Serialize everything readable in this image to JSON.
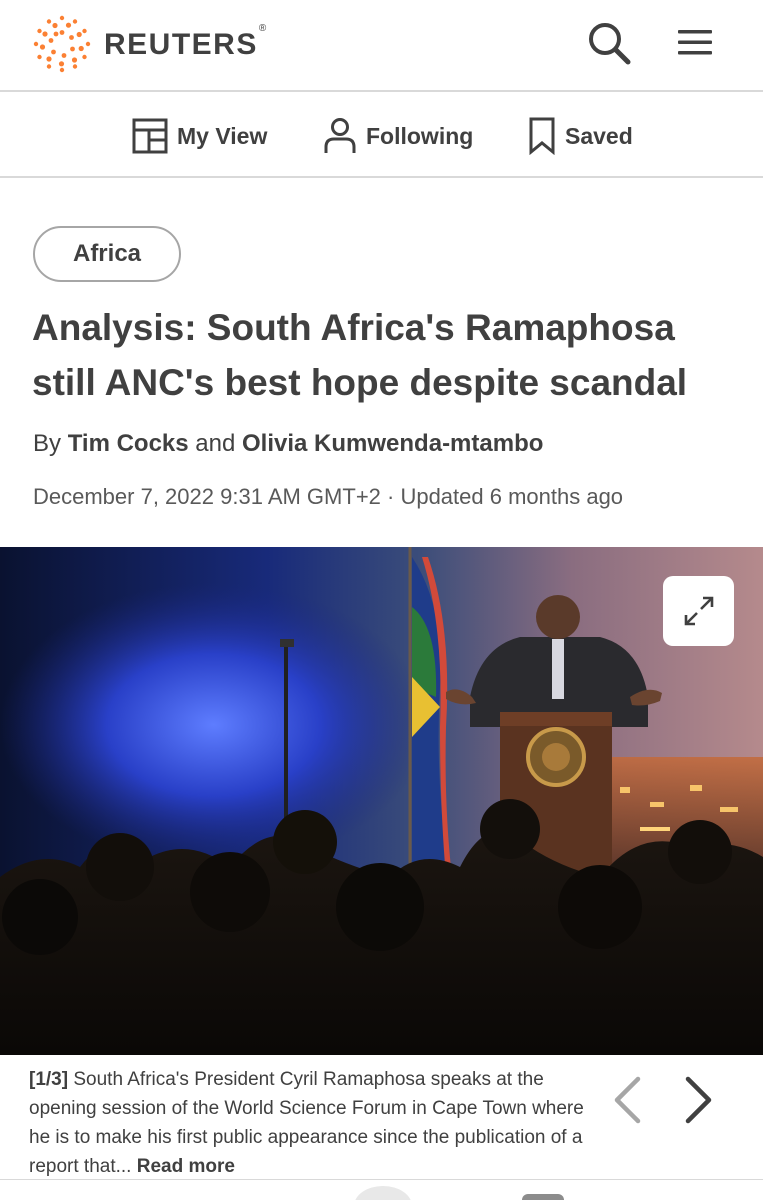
{
  "header": {
    "brand": "REUTERS",
    "registered": "®",
    "brand_color": "#fb8033",
    "icons": [
      "search-icon",
      "hamburger-menu-icon"
    ]
  },
  "nav": {
    "items": [
      {
        "label": "My View",
        "icon": "layout-icon"
      },
      {
        "label": "Following",
        "icon": "person-icon"
      },
      {
        "label": "Saved",
        "icon": "bookmark-icon"
      }
    ]
  },
  "article": {
    "tag": "Africa",
    "headline": "Analysis: South Africa's Ramaphosa still ANC's best hope despite scandal",
    "byline_prefix": "By",
    "byline_and": "and",
    "authors": [
      "Tim Cocks",
      "Olivia Kumwenda-mtambo"
    ],
    "dateline": "December 7, 2022 9:31 AM GMT+2 · Updated 6 months ago"
  },
  "media": {
    "expand_icon": "expand-arrows-icon",
    "caption_count": "[1/3]",
    "caption_text": "South Africa's President Cyril Ramaphosa speaks at the opening session of the World Science Forum in Cape Town where he is to make his first public appearance since the publication of a report that...",
    "read_more": "Read more",
    "prev_icon": "chevron-left-icon",
    "next_icon": "chevron-right-icon"
  }
}
